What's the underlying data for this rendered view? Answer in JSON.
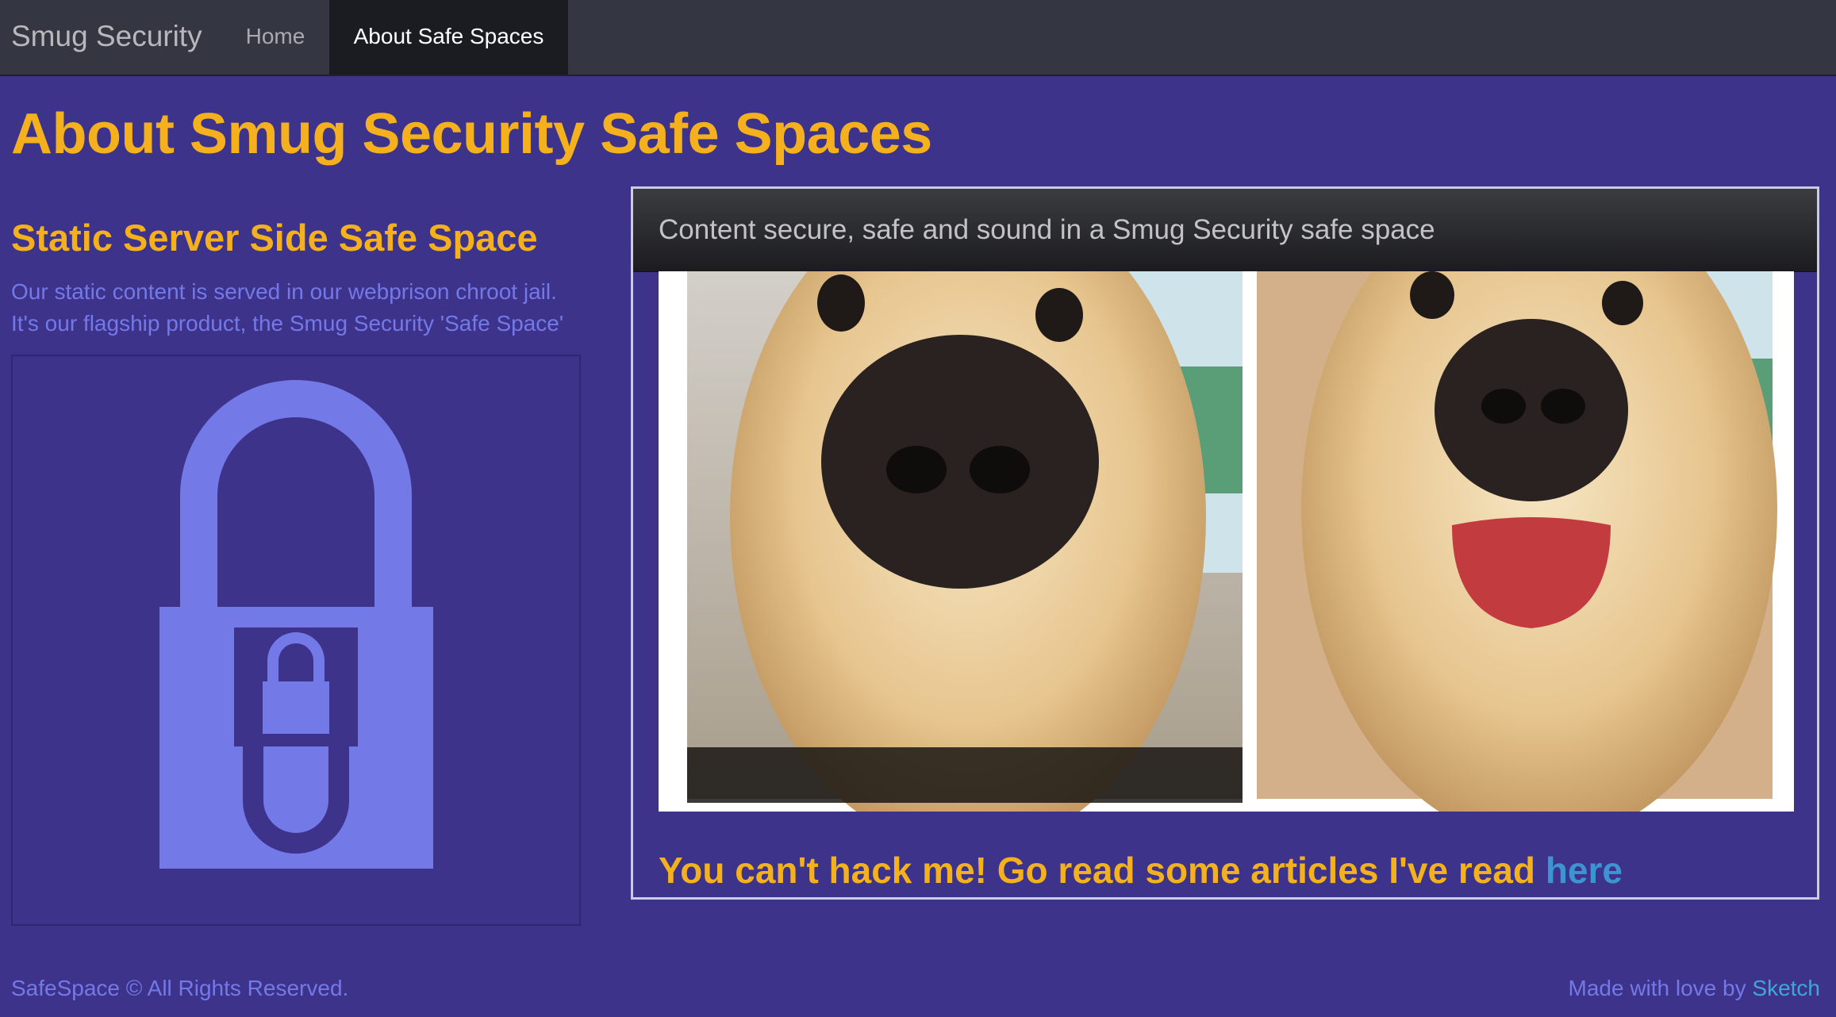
{
  "navbar": {
    "brand": "Smug Security",
    "items": [
      {
        "label": "Home",
        "active": false
      },
      {
        "label": "About Safe Spaces",
        "active": true
      }
    ]
  },
  "page": {
    "title": "About Smug Security Safe Spaces"
  },
  "left_section": {
    "title": "Static Server Side Safe Space",
    "description_lines": [
      "Our static content is served in our webprison chroot jail.",
      "It's our flagship product, the Smug Security 'Safe Space'"
    ],
    "image_icon": "padlock-icon"
  },
  "panel": {
    "heading": "Content secure, safe and sound in a Smug Security safe space",
    "image": "two-puppy-closeup-photo",
    "cta_text": "You can't hack me! Go read some articles I've read ",
    "cta_link": "here"
  },
  "footer": {
    "left": "SafeSpace © All Rights Reserved.",
    "right_text": "Made with love by ",
    "right_link": "Sketch"
  },
  "colors": {
    "background": "#3d338a",
    "navbar": "#343741",
    "accent_yellow": "#f5b11d",
    "text_purple": "#7479e8",
    "link_blue": "#3c95d3"
  }
}
